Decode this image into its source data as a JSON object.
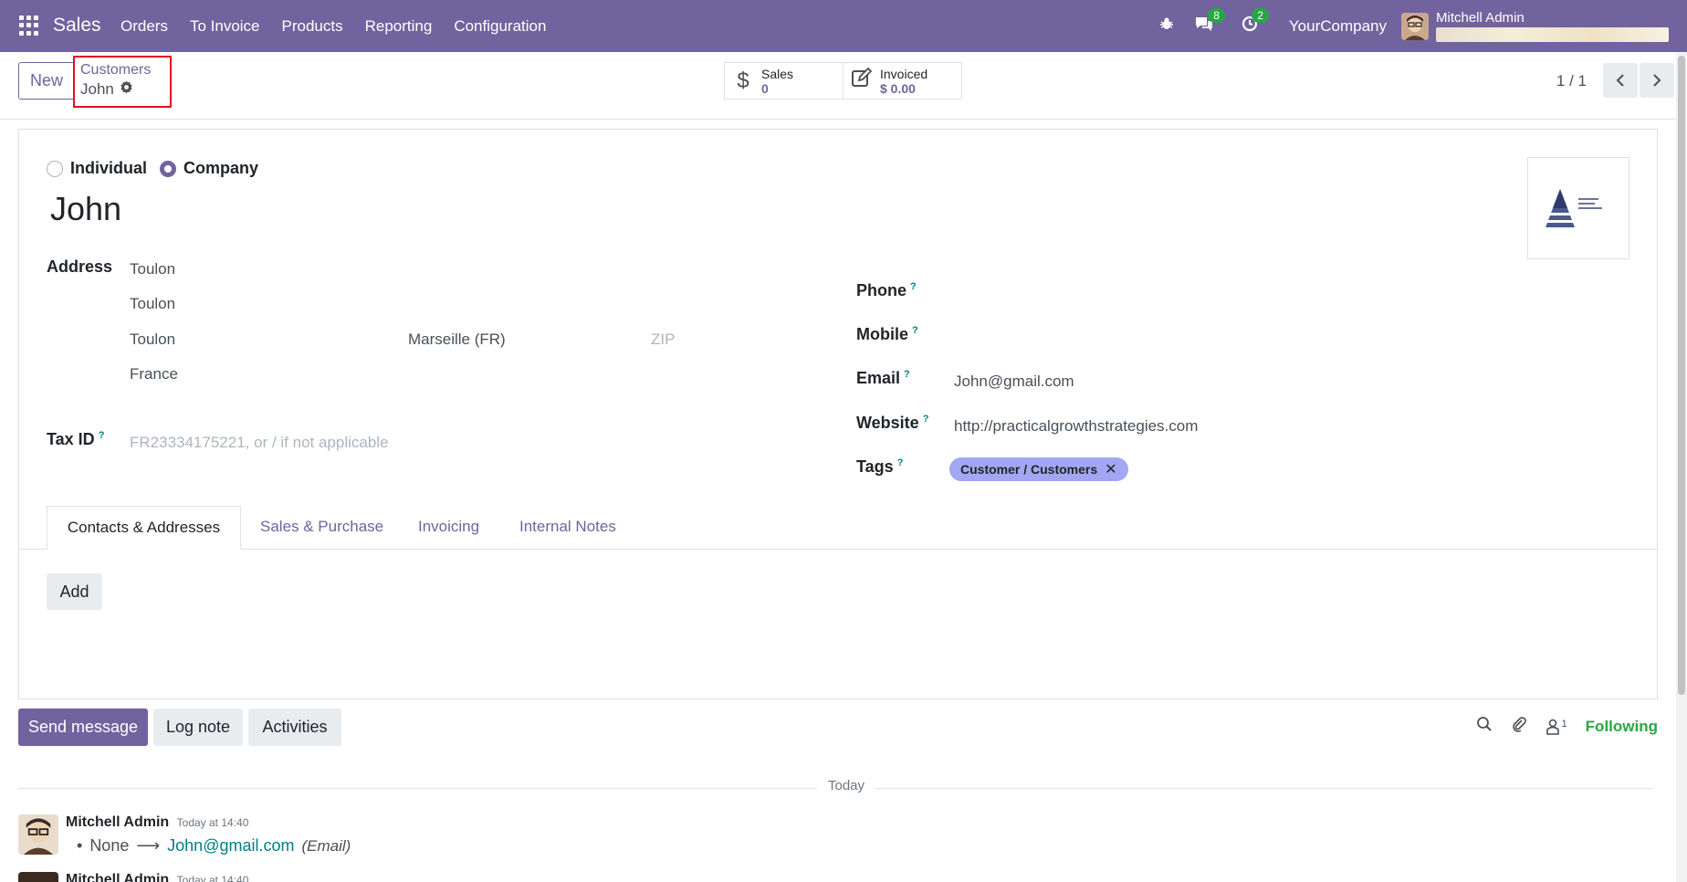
{
  "navbar": {
    "app_name": "Sales",
    "menu": [
      "Orders",
      "To Invoice",
      "Products",
      "Reporting",
      "Configuration"
    ],
    "messages_count": "8",
    "activities_count": "2",
    "company": "YourCompany",
    "user": "Mitchell Admin",
    "color": "#71639e"
  },
  "control": {
    "new_label": "New",
    "breadcrumb_parent": "Customers",
    "breadcrumb_current": "John",
    "smart_sales_label": "Sales",
    "smart_sales_value": "0",
    "smart_invoiced_label": "Invoiced",
    "smart_invoiced_value": "$ 0.00",
    "pager": "1 / 1"
  },
  "form": {
    "type_individual": "Individual",
    "type_company": "Company",
    "selected_type": "Company",
    "name": "John",
    "address_label": "Address",
    "street": "Toulon",
    "street2": "Toulon",
    "city": "Toulon",
    "state": "Marseille (FR)",
    "zip_placeholder": "ZIP",
    "country": "France",
    "tax_label": "Tax ID",
    "tax_placeholder": "FR23334175221, or / if not applicable",
    "phone_label": "Phone",
    "mobile_label": "Mobile",
    "email_label": "Email",
    "email": "John@gmail.com",
    "website_label": "Website",
    "website": "http://practicalgrowthstrategies.com",
    "tags_label": "Tags",
    "tag": "Customer / Customers",
    "help_mark": "?"
  },
  "tabs": [
    "Contacts & Addresses",
    "Sales & Purchase",
    "Invoicing",
    "Internal Notes"
  ],
  "add_label": "Add",
  "chatter": {
    "send_message": "Send message",
    "log_note": "Log note",
    "activities": "Activities",
    "followers_count": "1",
    "following": "Following",
    "date_separator": "Today",
    "messages": [
      {
        "author": "Mitchell Admin",
        "time": "Today at 14:40",
        "old": "None",
        "new": "John@gmail.com",
        "field": "(Email)"
      },
      {
        "author": "Mitchell Admin",
        "time": "Today at 14:40"
      }
    ]
  }
}
